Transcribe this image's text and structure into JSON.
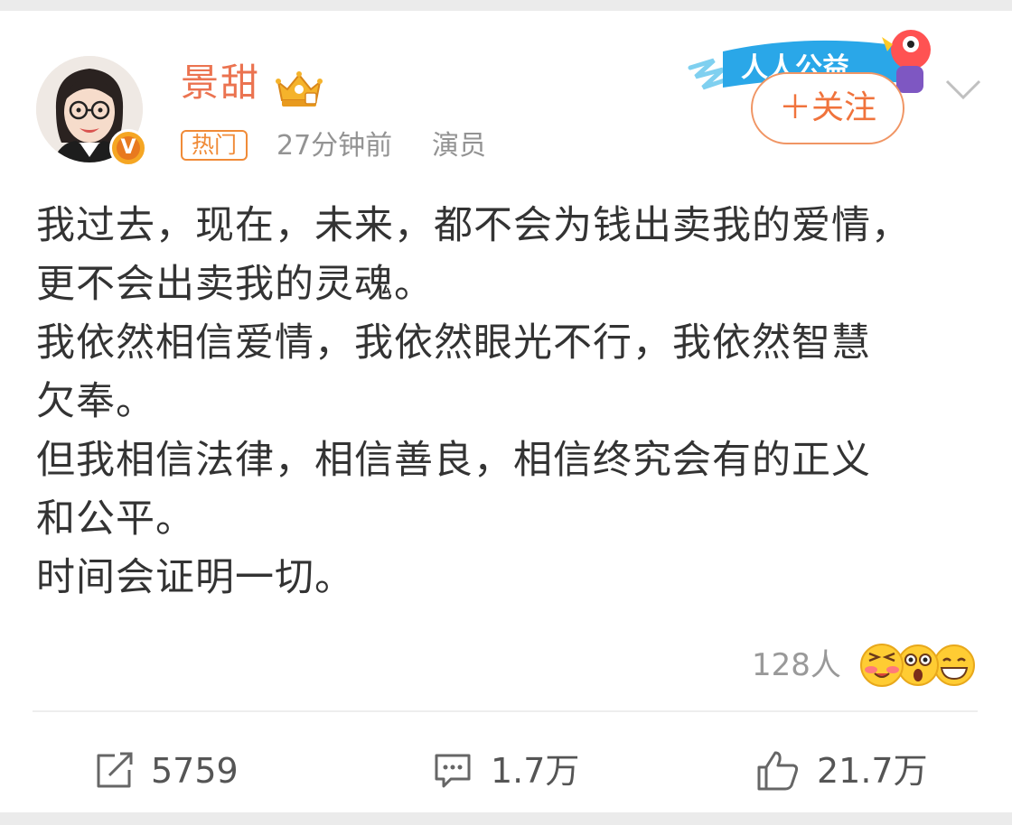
{
  "post": {
    "author": {
      "name": "景甜",
      "avatar_icon": "avatar-photo",
      "verified_badge": "V",
      "crown_icon": "crown-icon"
    },
    "hot_tag": "热门",
    "time": "27分钟前",
    "source": "演员",
    "follow_button": "＋关注",
    "banner_text": "人人公益",
    "content_lines": [
      "我过去，现在，未来，都不会为钱出卖我的爱情，",
      "更不会出卖我的灵魂。",
      "我依然相信爱情，我依然眼光不行，我依然智慧",
      "欠奉。",
      "但我相信法律，相信善良，相信终究会有的正义",
      "和公平。",
      "时间会证明一切。"
    ],
    "reactions": {
      "count": "128人",
      "emojis": [
        "blush-emoji",
        "surprised-emoji",
        "grin-emoji"
      ]
    },
    "actions": {
      "repost": "5759",
      "comment": "1.7万",
      "like": "21.7万"
    }
  },
  "colors": {
    "username": "#eb7350",
    "accent_orange": "#f08b38",
    "text": "#333333",
    "meta": "#939393"
  }
}
